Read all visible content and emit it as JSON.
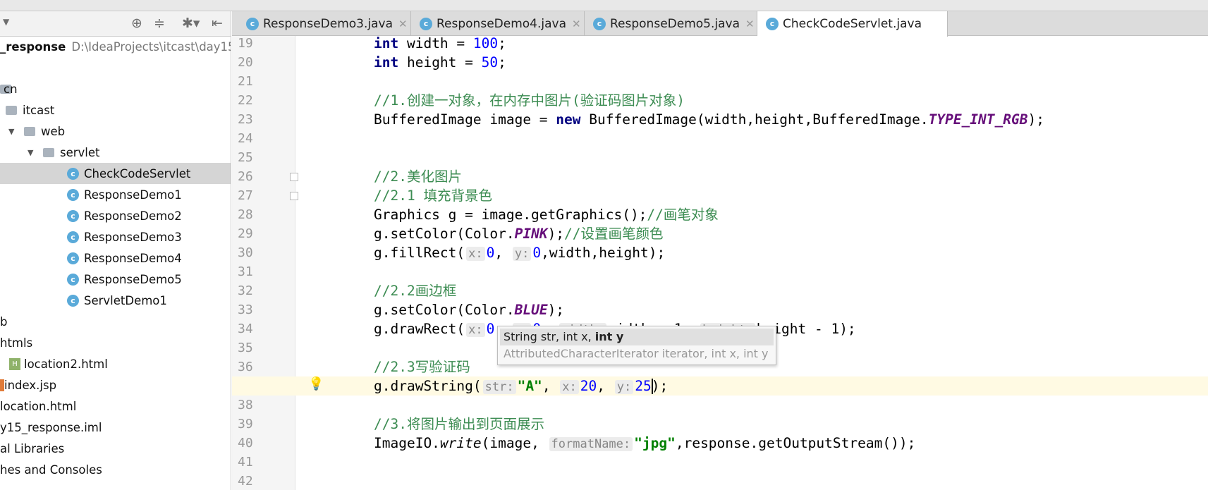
{
  "sidebar": {
    "toolbar": [
      {
        "icon": "locate-icon",
        "glyph": "⊕"
      },
      {
        "icon": "collapse-icon",
        "glyph": "≑"
      },
      {
        "icon": "gear-icon",
        "glyph": "✱▾"
      },
      {
        "icon": "hide-icon",
        "glyph": "⇤"
      }
    ],
    "project": {
      "name": "_response",
      "path": "D:\\IdeaProjects\\itcast\\day15_"
    },
    "items": [
      {
        "label": "",
        "depth": 0,
        "type": "none"
      },
      {
        "label": "cn",
        "depth": 0,
        "type": "folder-open"
      },
      {
        "label": "itcast",
        "depth": 1,
        "type": "folder"
      },
      {
        "label": "web",
        "depth": 2,
        "type": "folder-open"
      },
      {
        "label": "servlet",
        "depth": 3,
        "type": "folder-open"
      },
      {
        "label": "CheckCodeServlet",
        "depth": 4,
        "type": "class",
        "selected": true
      },
      {
        "label": "ResponseDemo1",
        "depth": 4,
        "type": "class"
      },
      {
        "label": "ResponseDemo2",
        "depth": 4,
        "type": "class"
      },
      {
        "label": "ResponseDemo3",
        "depth": 4,
        "type": "class"
      },
      {
        "label": "ResponseDemo4",
        "depth": 4,
        "type": "class"
      },
      {
        "label": "ResponseDemo5",
        "depth": 4,
        "type": "class"
      },
      {
        "label": "ServletDemo1",
        "depth": 4,
        "type": "class"
      },
      {
        "label": "b",
        "depth": 0,
        "type": "none"
      },
      {
        "label": "htmls",
        "depth": 0,
        "type": "none"
      },
      {
        "label": "location2.html",
        "depth": 1,
        "type": "html"
      },
      {
        "label": "index.jsp",
        "depth": 0,
        "type": "jsp"
      },
      {
        "label": "location.html",
        "depth": 0,
        "type": "none"
      },
      {
        "label": "y15_response.iml",
        "depth": 0,
        "type": "none"
      },
      {
        "label": "al Libraries",
        "depth": 0,
        "type": "none"
      },
      {
        "label": "hes and Consoles",
        "depth": 0,
        "type": "none"
      }
    ]
  },
  "tabs": [
    {
      "label": "ResponseDemo3.java",
      "active": false
    },
    {
      "label": "ResponseDemo4.java",
      "active": false
    },
    {
      "label": "ResponseDemo5.java",
      "active": false
    },
    {
      "label": "CheckCodeServlet.java",
      "active": true
    }
  ],
  "editor": {
    "current_line": 37,
    "fold_lines": [
      26,
      27
    ],
    "bulb_line": 37,
    "lines": [
      {
        "n": 19,
        "tokens": [
          [
            "kw",
            "int"
          ],
          [
            "",
            "width = "
          ],
          [
            "nm",
            "100"
          ],
          [
            "",
            ";"
          ]
        ]
      },
      {
        "n": 20,
        "tokens": [
          [
            "kw",
            "int"
          ],
          [
            "",
            "height = "
          ],
          [
            "nm",
            "50"
          ],
          [
            "",
            ";"
          ]
        ]
      },
      {
        "n": 21,
        "tokens": []
      },
      {
        "n": 22,
        "tokens": [
          [
            "cm",
            "//1.创建一对象，在内存中图片(验证码图片对象)"
          ]
        ]
      },
      {
        "n": 23,
        "tokens": [
          [
            "",
            "BufferedImage image = "
          ],
          [
            "kw",
            "new"
          ],
          [
            "",
            "BufferedImage(width,height,BufferedImage."
          ],
          [
            "st",
            "TYPE_INT_RGB"
          ],
          [
            "",
            ");"
          ]
        ]
      },
      {
        "n": 24,
        "tokens": []
      },
      {
        "n": 25,
        "tokens": []
      },
      {
        "n": 26,
        "tokens": [
          [
            "cm",
            "//2.美化图片"
          ]
        ]
      },
      {
        "n": 27,
        "tokens": [
          [
            "cm",
            "//2.1 填充背景色"
          ]
        ]
      },
      {
        "n": 28,
        "tokens": [
          [
            "",
            "Graphics g = image.getGraphics();"
          ],
          [
            "cm",
            "//画笔对象"
          ]
        ]
      },
      {
        "n": 29,
        "tokens": [
          [
            "",
            "g.setColor(Color."
          ],
          [
            "st",
            "PINK"
          ],
          [
            "",
            ");"
          ],
          [
            "cm",
            "//设置画笔颜色"
          ]
        ]
      },
      {
        "n": 30,
        "tokens": [
          [
            "",
            "g.fillRect("
          ],
          [
            "hint",
            "x:"
          ],
          [
            "nm",
            "0"
          ],
          [
            "",
            ", "
          ],
          [
            "hint",
            "y:"
          ],
          [
            "nm",
            "0"
          ],
          [
            "",
            ",width,height);"
          ]
        ]
      },
      {
        "n": 31,
        "tokens": []
      },
      {
        "n": 32,
        "tokens": [
          [
            "cm",
            "//2.2画边框"
          ]
        ]
      },
      {
        "n": 33,
        "tokens": [
          [
            "",
            "g.setColor(Color."
          ],
          [
            "st",
            "BLUE"
          ],
          [
            "",
            ");"
          ]
        ]
      },
      {
        "n": 34,
        "tokens": [
          [
            "",
            "g.drawRect("
          ],
          [
            "hint",
            "x:"
          ],
          [
            "nm",
            "0"
          ],
          [
            "",
            ", "
          ],
          [
            "hint",
            "y:"
          ],
          [
            "nm",
            "0"
          ],
          [
            "",
            ", "
          ],
          [
            "hint",
            "width:"
          ],
          [
            "",
            "width - 1, "
          ],
          [
            "hint",
            "height:"
          ],
          [
            "",
            "height - 1);"
          ]
        ]
      },
      {
        "n": 35,
        "tokens": []
      },
      {
        "n": 36,
        "tokens": [
          [
            "cm",
            "//2.3写验证码"
          ]
        ]
      },
      {
        "n": 37,
        "tokens": [
          [
            "",
            "g.drawString("
          ],
          [
            "hint",
            "str:"
          ],
          [
            "str",
            "\"A\""
          ],
          [
            "",
            ", "
          ],
          [
            "hint",
            "x:"
          ],
          [
            "nm",
            "20"
          ],
          [
            "",
            ", "
          ],
          [
            "hint",
            "y:"
          ],
          [
            "nm",
            "25"
          ],
          [
            "",
            ");"
          ]
        ]
      },
      {
        "n": 38,
        "tokens": []
      },
      {
        "n": 39,
        "tokens": [
          [
            "cm",
            "//3.将图片输出到页面展示"
          ]
        ]
      },
      {
        "n": 40,
        "tokens": [
          [
            "",
            "ImageIO."
          ],
          [
            "sm",
            "write"
          ],
          [
            "",
            "(image, "
          ],
          [
            "hint",
            "formatName:"
          ],
          [
            "str",
            "\"jpg\""
          ],
          [
            "",
            ",response.getOutputStream());"
          ]
        ]
      },
      {
        "n": 41,
        "tokens": []
      },
      {
        "n": 42,
        "tokens": []
      }
    ]
  },
  "param_popup": {
    "line1_prefix": "String str, int x, ",
    "line1_bold": "int y",
    "line2": "AttributedCharacterIterator iterator, int x, int y"
  }
}
